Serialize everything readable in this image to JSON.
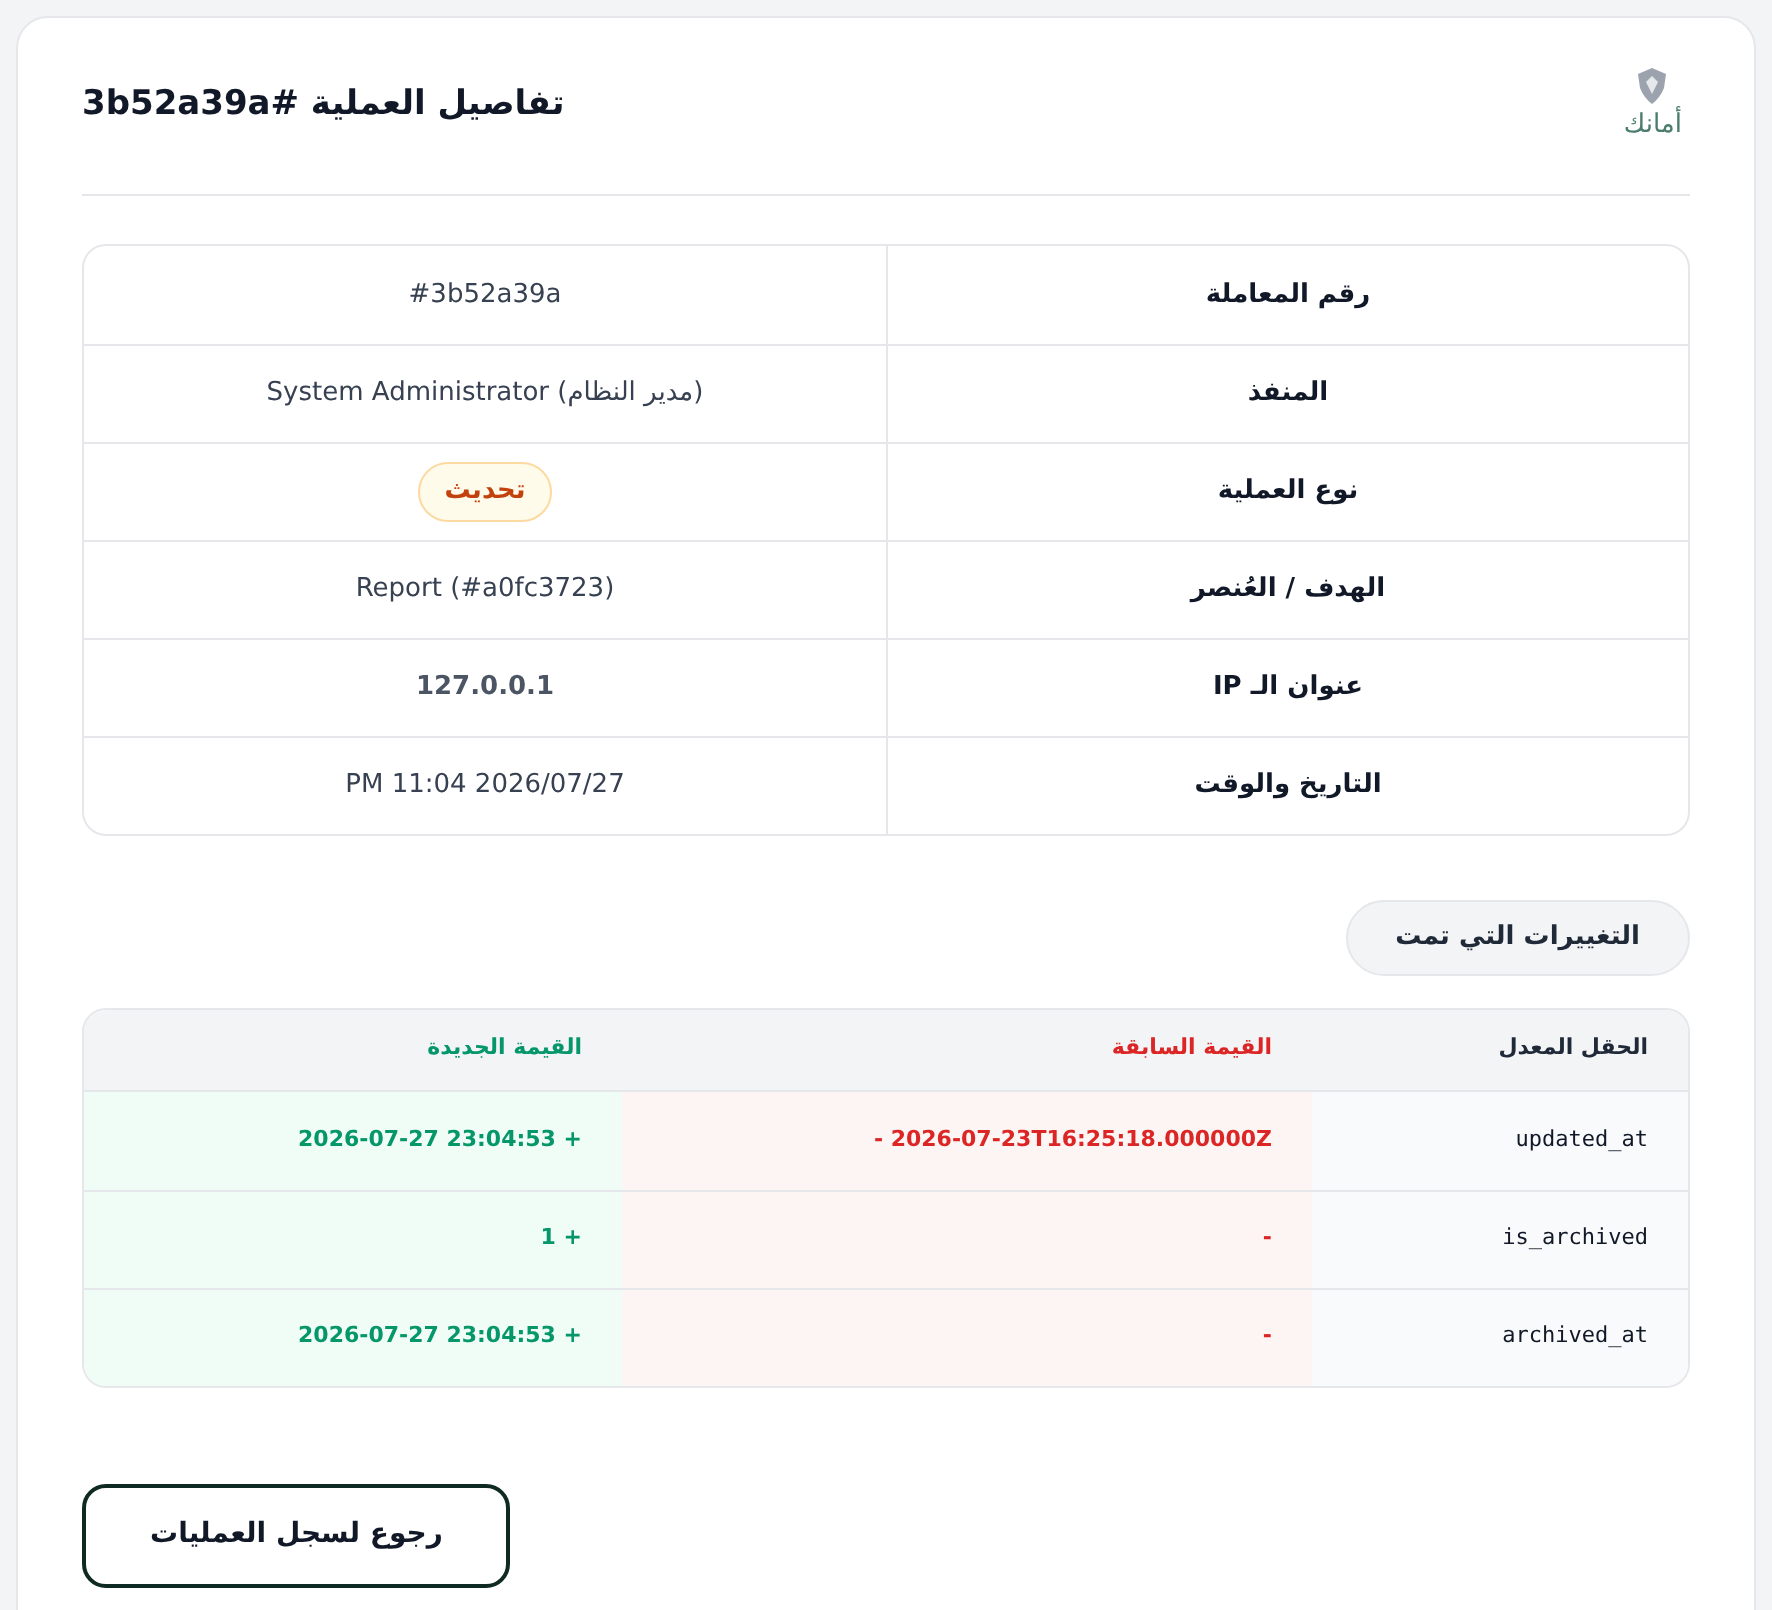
{
  "header": {
    "title": "تفاصيل العملية #3b52a39a",
    "logo_text": "أمانك"
  },
  "details": [
    {
      "label": "رقم المعاملة",
      "value": "#3b52a39a",
      "kind": "text"
    },
    {
      "label": "المنفذ",
      "value": "System Administrator (مدير النظام)",
      "kind": "text"
    },
    {
      "label": "نوع العملية",
      "value": "تحديث",
      "kind": "badge",
      "color": "#c2410c"
    },
    {
      "label": "الهدف / العُنصر",
      "value": "Report (#a0fc3723)",
      "kind": "text"
    },
    {
      "label": "عنوان الـ IP",
      "value": "127.0.0.1",
      "kind": "bold"
    },
    {
      "label": "التاريخ والوقت",
      "value": "PM 11:04 2026/07/27",
      "kind": "text"
    }
  ],
  "changes": {
    "heading": "التغييرات التي تمت",
    "columns": [
      "الحقل المعدل",
      "القيمة السابقة",
      "القيمة الجديدة"
    ],
    "rows": [
      {
        "field": "updated_at",
        "old": "- 2026-07-23T16:25:18.000000Z",
        "new": "2026-07-27 23:04:53 +"
      },
      {
        "field": "is_archived",
        "old": "-",
        "new": "1 +"
      },
      {
        "field": "archived_at",
        "old": "-",
        "new": "2026-07-27 23:04:53 +"
      }
    ]
  },
  "back_button": "رجوع لسجل العمليات"
}
